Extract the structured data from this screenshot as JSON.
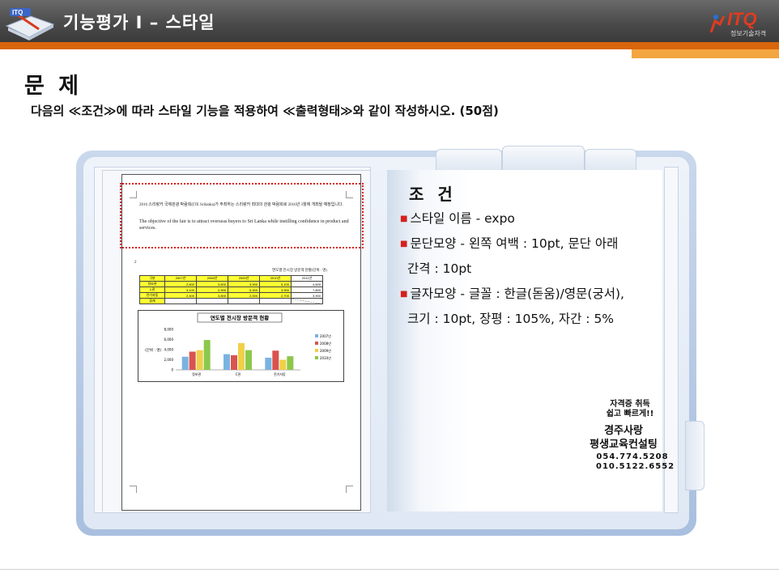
{
  "header": {
    "title": "기능평가 I – 스타일",
    "logo_text": "ITQ",
    "logo_subtext": "정보기술자격"
  },
  "problem": {
    "title": "문 제",
    "description": "다음의 ≪조건≫에 따라 스타일 기능을 적용하여 ≪출력형태≫와 같이 작성하시오. (50점)"
  },
  "doc": {
    "korean_text": "2016 스리랑카 국제관광 박람회(ITE Srilanka)가 주최하는 스리랑카 최대의 관광 박람회로 2016년 3월에 개최될 예정입니다.",
    "english_text": "The objective of the fair is to attract overseas buyers to Sri Lanka while instilling confidence in product and services.",
    "section_number": "2",
    "table_title": "연도별 전시장 방문객 현황(단위 : 명)",
    "table": {
      "headers": [
        "구분",
        "2007년",
        "2008년",
        "2009년",
        "2010년",
        "2011년"
      ],
      "rows": [
        [
          "정보관",
          "2,600",
          "3,600",
          "3,900",
          "5,100",
          "4,600"
        ],
        [
          "C관",
          "3,100",
          "2,900",
          "5,300",
          "3,900",
          "7,800"
        ],
        [
          "전기자동",
          "2,400",
          "3,800",
          "2,000",
          "2,700",
          "3,900"
        ],
        [
          "합계",
          "",
          "",
          "",
          "",
          ""
        ]
      ]
    },
    "chart": {
      "title": "연도별 전시장 방문객 현황",
      "ylabel": "(단위 : 명)",
      "yticks": [
        "8,000",
        "6,000",
        "4,000",
        "2,000",
        "0"
      ],
      "legend": [
        "2007년",
        "2008년",
        "2009년",
        "2010년"
      ]
    }
  },
  "chart_data": {
    "type": "bar",
    "title": "연도별 전시장 방문객 현황",
    "ylabel": "(단위 : 명)",
    "categories": [
      "정보관",
      "C관",
      "전기자동"
    ],
    "ylim": [
      0,
      8000
    ],
    "series": [
      {
        "name": "2007년",
        "color": "#7ab3e0",
        "values": [
          2600,
          3100,
          2400
        ]
      },
      {
        "name": "2008년",
        "color": "#d9534f",
        "values": [
          3600,
          2900,
          3800
        ]
      },
      {
        "name": "2009년",
        "color": "#f0d048",
        "values": [
          3900,
          5300,
          2000
        ]
      },
      {
        "name": "2010년",
        "color": "#8cc84b",
        "values": [
          5900,
          3900,
          2700
        ]
      }
    ]
  },
  "conditions": {
    "title": "조 건",
    "items": [
      "스타일 이름 - expo",
      "문단모양 - 왼쪽 여백 : 10pt, 문단 아래",
      "간격 : 10pt",
      "글자모양 - 글꼴 : 한글(돋움)/영문(궁서),",
      "크기 : 10pt, 장평 : 105%, 자간 : 5%"
    ]
  },
  "promo": {
    "slogan_1": "자격증 취득",
    "slogan_2": "쉽고 빠르게!!",
    "org_1": "경주사랑",
    "org_2": "평생교육컨설팅",
    "phone_1": "054.774.5208",
    "phone_2": "010.5122.6552"
  }
}
